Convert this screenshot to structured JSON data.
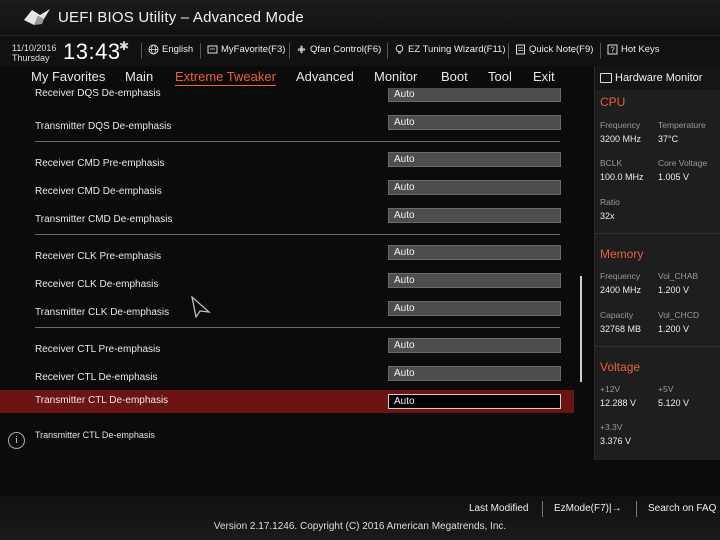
{
  "title": "UEFI BIOS Utility – Advanced Mode",
  "datetime": {
    "date": "11/10/2016",
    "day": "Thursday",
    "time": "13:43"
  },
  "toolbar": [
    {
      "label": "English",
      "icon": "globe-icon"
    },
    {
      "label": "MyFavorite(F3)",
      "icon": "favorite-icon"
    },
    {
      "label": "Qfan Control(F6)",
      "icon": "fan-icon"
    },
    {
      "label": "EZ Tuning Wizard(F11)",
      "icon": "bulb-icon"
    },
    {
      "label": "Quick Note(F9)",
      "icon": "note-icon"
    },
    {
      "label": "Hot Keys",
      "icon": "help-icon"
    }
  ],
  "menu": {
    "items": [
      "My Favorites",
      "Main",
      "Extreme Tweaker",
      "Advanced",
      "Monitor",
      "Boot",
      "Tool",
      "Exit"
    ],
    "active": "Extreme Tweaker"
  },
  "settings": [
    {
      "label": "Receiver DQS De-emphasis",
      "value": "Auto"
    },
    {
      "label": "Transmitter DQS De-emphasis",
      "value": "Auto"
    },
    {
      "label": "Receiver CMD Pre-emphasis",
      "value": "Auto"
    },
    {
      "label": "Receiver CMD De-emphasis",
      "value": "Auto"
    },
    {
      "label": "Transmitter CMD De-emphasis",
      "value": "Auto"
    },
    {
      "label": "Receiver CLK Pre-emphasis",
      "value": "Auto"
    },
    {
      "label": "Receiver CLK De-emphasis",
      "value": "Auto"
    },
    {
      "label": "Transmitter CLK De-emphasis",
      "value": "Auto"
    },
    {
      "label": "Receiver CTL Pre-emphasis",
      "value": "Auto"
    },
    {
      "label": "Receiver CTL De-emphasis",
      "value": "Auto"
    },
    {
      "label": "Transmitter CTL De-emphasis",
      "value": "Auto"
    }
  ],
  "help_text": "Transmitter CTL De-emphasis",
  "hardware_monitor": {
    "title": "Hardware Monitor",
    "cpu": {
      "heading": "CPU",
      "frequency_label": "Frequency",
      "frequency": "3200 MHz",
      "temperature_label": "Temperature",
      "temperature": "37°C",
      "bclk_label": "BCLK",
      "bclk": "100.0 MHz",
      "core_voltage_label": "Core Voltage",
      "core_voltage": "1.005 V",
      "ratio_label": "Ratio",
      "ratio": "32x"
    },
    "memory": {
      "heading": "Memory",
      "frequency_label": "Frequency",
      "frequency": "2400 MHz",
      "vol_chab_label": "Vol_CHAB",
      "vol_chab": "1.200 V",
      "capacity_label": "Capacity",
      "capacity": "32768 MB",
      "vol_chcd_label": "Vol_CHCD",
      "vol_chcd": "1.200 V"
    },
    "voltage": {
      "heading": "Voltage",
      "v12_label": "+12V",
      "v12": "12.288 V",
      "v5_label": "+5V",
      "v5": "5.120 V",
      "v33_label": "+3.3V",
      "v33": "3.376 V"
    }
  },
  "bottom": {
    "last_modified": "Last Modified",
    "ezmode": "EzMode(F7)|→",
    "search": "Search on FAQ",
    "copyright": "Version 2.17.1246. Copyright (C) 2016 American Megatrends, Inc."
  },
  "colors": {
    "accent": "#e8603b",
    "selected_row": "#6b1412"
  }
}
